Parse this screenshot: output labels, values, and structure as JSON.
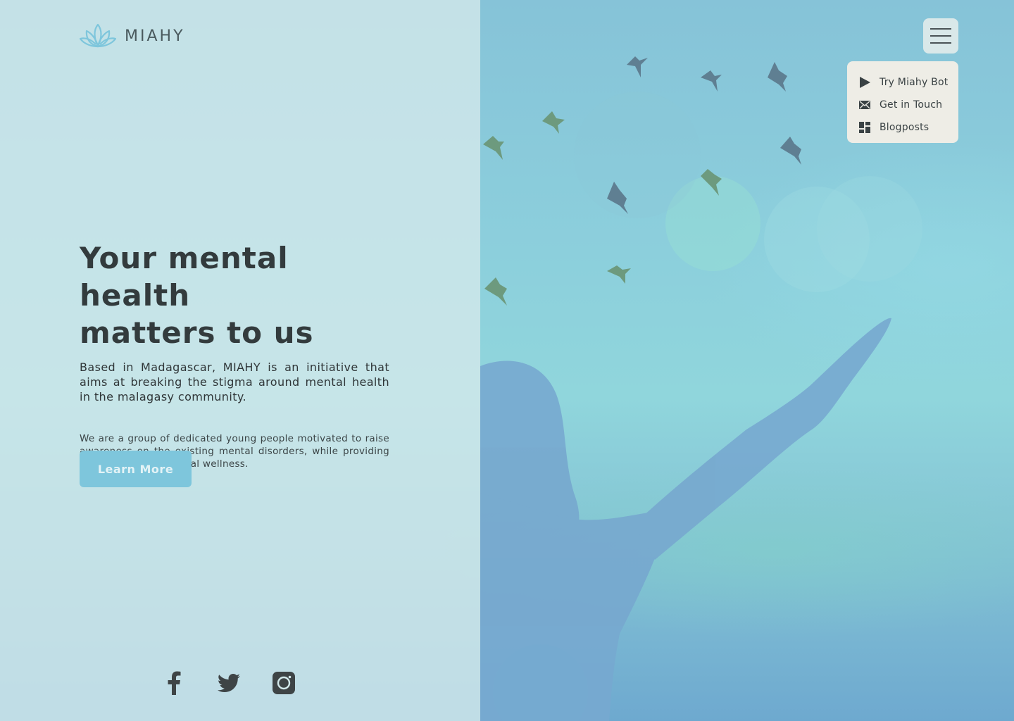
{
  "brand": {
    "name": "MIAHY",
    "logo_icon": "lotus-icon",
    "accent": "#7ec6dc"
  },
  "hero": {
    "title_line1": "Your mental health",
    "title_line2": "matters to us",
    "subtitle": "Based in Madagascar, MIAHY is an initiative that aims at breaking the stigma around mental health in the malagasy community.",
    "body": "We are a group of dedicated young people motivated to raise awareness on the existing mental disorders, while providing tools to promote mental wellness.",
    "cta_label": "Learn More"
  },
  "menu": {
    "toggle_icon": "hamburger-menu-icon",
    "items": [
      {
        "label": "Try Miahy Bot",
        "icon": "play-icon"
      },
      {
        "label": "Get in Touch",
        "icon": "envelope-icon"
      },
      {
        "label": "Blogposts",
        "icon": "dashboard-icon"
      }
    ]
  },
  "social": [
    {
      "icon": "facebook-icon"
    },
    {
      "icon": "twitter-icon"
    },
    {
      "icon": "instagram-icon"
    }
  ],
  "colors": {
    "text_dark": "#333b3d",
    "panel": "#d2e8ea",
    "sky": "#8cc6d8"
  }
}
